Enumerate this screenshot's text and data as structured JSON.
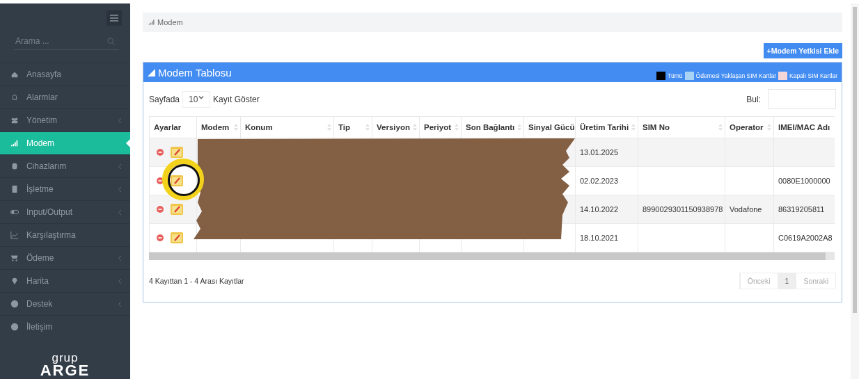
{
  "sidebar": {
    "search": {
      "placeholder": "Arama ..."
    },
    "items": [
      {
        "label": "Anasayfa",
        "submenu": false,
        "selected": false
      },
      {
        "label": "Alarmlar",
        "submenu": false,
        "selected": false
      },
      {
        "label": "Yönetim",
        "submenu": true,
        "selected": false
      },
      {
        "label": "Modem",
        "submenu": false,
        "selected": true
      },
      {
        "label": "Cihazlarım",
        "submenu": true,
        "selected": false
      },
      {
        "label": "İşletme",
        "submenu": true,
        "selected": false
      },
      {
        "label": "Input/Output",
        "submenu": true,
        "selected": false
      },
      {
        "label": "Karşılaştırma",
        "submenu": false,
        "selected": false
      },
      {
        "label": "Ödeme",
        "submenu": true,
        "selected": false
      },
      {
        "label": "Harita",
        "submenu": true,
        "selected": false
      },
      {
        "label": "Destek",
        "submenu": true,
        "selected": false
      },
      {
        "label": "İletişim",
        "submenu": false,
        "selected": false
      }
    ],
    "logo": {
      "top": "grup",
      "bottom": "ARGE"
    }
  },
  "breadcrumb": "Modem",
  "add_button": "+Modem Yetkisi Ekle",
  "panel": {
    "title": "Modem Tablosu",
    "legend": [
      {
        "label": "Tümü",
        "color": "#000000"
      },
      {
        "label": "Ödemesi Yaklaşan SIM Kartlar",
        "color": "#a9d3f5"
      },
      {
        "label": "Kapalı SIM Kartlar",
        "color": "#f5d5d5"
      }
    ],
    "page_size_label": "Sayfada",
    "page_size": "10",
    "page_size_suffix": "Kayıt Göster",
    "search_label": "Bul:",
    "columns": [
      {
        "label": "Ayarlar",
        "sortable": false
      },
      {
        "label": "Modem",
        "sortable": true
      },
      {
        "label": "Konum",
        "sortable": true
      },
      {
        "label": "Tip",
        "sortable": true
      },
      {
        "label": "Versiyon",
        "sortable": true
      },
      {
        "label": "Periyot",
        "sortable": true
      },
      {
        "label": "Son Bağlantı",
        "sortable": true
      },
      {
        "label": "Sinyal Gücü",
        "sortable": false
      },
      {
        "label": "Üretim Tarihi",
        "sortable": true
      },
      {
        "label": "SIM No",
        "sortable": true
      },
      {
        "label": "Operator",
        "sortable": true
      },
      {
        "label": "IMEI/MAC Adı",
        "sortable": false
      }
    ],
    "rows": [
      {
        "production_date": "13.01.2025"
      },
      {
        "production_date": "02.02.2023",
        "imei": "0080E1000000"
      },
      {
        "production_date": "14.10.2022",
        "sim_no": "8990029301150938978",
        "operator": "Vodafone",
        "imei": "86319205811"
      },
      {
        "production_date": "18.10.2021",
        "imei": "C0619A2002A8"
      }
    ],
    "info": "4 Kayıttan 1 - 4 Arası Kayıtlar",
    "pagination": [
      {
        "label": "Önceki",
        "selected": false
      },
      {
        "label": "1",
        "selected": true
      },
      {
        "label": "Sonraki",
        "selected": false
      }
    ]
  }
}
